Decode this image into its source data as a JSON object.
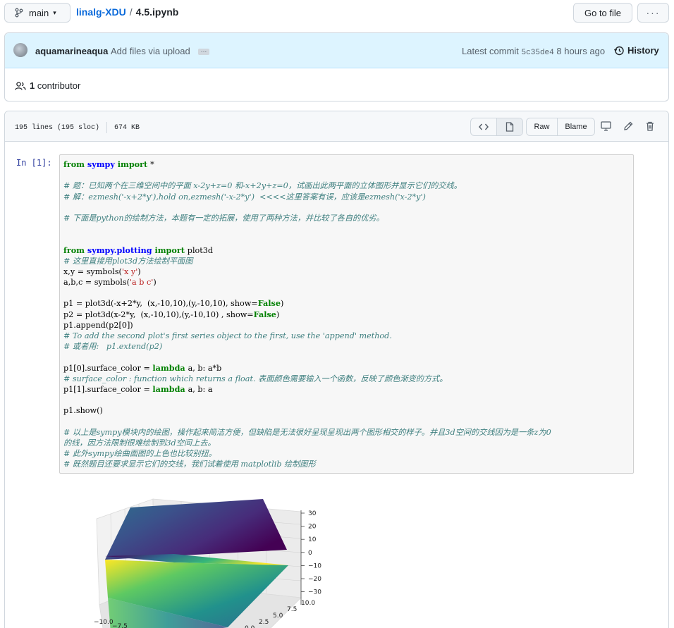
{
  "header": {
    "branch": "main",
    "repo": "linalg-XDU",
    "separator": "/",
    "file": "4.5.ipynb",
    "go_to_file": "Go to file",
    "more": "···"
  },
  "commit": {
    "author": "aquamarineaqua",
    "message": "Add files via upload",
    "ellipsis": "…",
    "latest_label": "Latest commit",
    "sha": "5c35de4",
    "time": "8 hours ago",
    "history": "History"
  },
  "contributors": {
    "count": "1",
    "label": "contributor"
  },
  "file_header": {
    "lines": "195 lines (195 sloc)",
    "size": "674 KB",
    "raw": "Raw",
    "blame": "Blame"
  },
  "cell": {
    "prompt": "In  [1]:",
    "code": [
      [
        [
          "kw",
          "from "
        ],
        [
          "ns",
          "sympy "
        ],
        [
          "kw",
          "import "
        ],
        [
          "",
          "*"
        ]
      ],
      [],
      [
        [
          "cm",
          "# 题：已知两个在三维空间中的平面 x-2y+z=0 和-x+2y+z=0，试画出此两平面的立体图形并显示它们的交线。"
        ]
      ],
      [
        [
          "cm",
          "# 解：ezmesh('-x+2*y'),hold on,ezmesh('-x-2*y')  <<<<这里答案有误，应该是ezmesh('x-2*y')"
        ]
      ],
      [],
      [
        [
          "cm",
          "# 下面是python的绘制方法，本题有一定的拓展，使用了两种方法，并比较了各自的优劣。"
        ]
      ],
      [],
      [],
      [
        [
          "kw",
          "from "
        ],
        [
          "ns",
          "sympy.plotting "
        ],
        [
          "kw",
          "import "
        ],
        [
          "",
          "plot3d"
        ]
      ],
      [
        [
          "cm",
          "# 这里直接用plot3d方法绘制平面图"
        ]
      ],
      [
        [
          "",
          "x,y = symbols("
        ],
        [
          "st",
          "'x y'"
        ],
        [
          "",
          ")"
        ]
      ],
      [
        [
          "",
          "a,b,c = symbols("
        ],
        [
          "st",
          "'a b c'"
        ],
        [
          "",
          ")"
        ]
      ],
      [],
      [
        [
          "",
          "p1 = plot3d(-x+2*y,  (x,-10,10),(y,-10,10), show="
        ],
        [
          "bi",
          "False"
        ],
        [
          "",
          ")"
        ]
      ],
      [
        [
          "",
          "p2 = plot3d(x-2*y,  (x,-10,10),(y,-10,10) , show="
        ],
        [
          "bi",
          "False"
        ],
        [
          "",
          ")"
        ]
      ],
      [
        [
          "",
          "p1.append(p2[0])"
        ]
      ],
      [
        [
          "cm",
          "# To add the second plot's first series object to the first, use the 'append' method."
        ]
      ],
      [
        [
          "cm",
          "# 或者用:   p1.extend(p2)"
        ]
      ],
      [],
      [
        [
          "",
          "p1[0].surface_color = "
        ],
        [
          "kw",
          "lambda "
        ],
        [
          "",
          "a, b: a*b"
        ]
      ],
      [
        [
          "cm",
          "# surface_color : function which returns a float. 表面颜色需要输入一个函数，反映了颜色渐变的方式。"
        ]
      ],
      [
        [
          "",
          "p1[1].surface_color = "
        ],
        [
          "kw",
          "lambda "
        ],
        [
          "",
          "a, b: a"
        ]
      ],
      [],
      [
        [
          "",
          "p1.show()"
        ]
      ],
      [],
      [
        [
          "cm",
          "# 以上是sympy模块内的绘图，操作起来简洁方便，但缺陷是无法很好呈现呈现出两个图形相交的样子。并且3d空间的交线因为是一条z为0"
        ]
      ],
      [
        [
          "cm",
          "的线，因方法限制很难绘制到3d空间上去。"
        ]
      ],
      [
        [
          "cm",
          "# 此外sympy绘曲面图的上色也比较别扭。"
        ]
      ],
      [
        [
          "cm",
          "# 既然题目还要求显示它们的交线，我们试着使用 matplotlib 绘制图形"
        ]
      ]
    ]
  },
  "plot": {
    "z_ticks": [
      "30",
      "20",
      "10",
      "0",
      "−10",
      "−20",
      "−30"
    ],
    "y_ticks": [
      "10.0",
      "7.5",
      "5.0",
      "2.5",
      "0.0"
    ],
    "x_ticks": [
      "−10.0",
      "−7.5"
    ]
  },
  "colors": {
    "accent": "#0969da",
    "commit_bg": "#ddf4ff",
    "viridis_dark": "#440154",
    "viridis_mid": "#21918c",
    "viridis_bright": "#fde725"
  }
}
